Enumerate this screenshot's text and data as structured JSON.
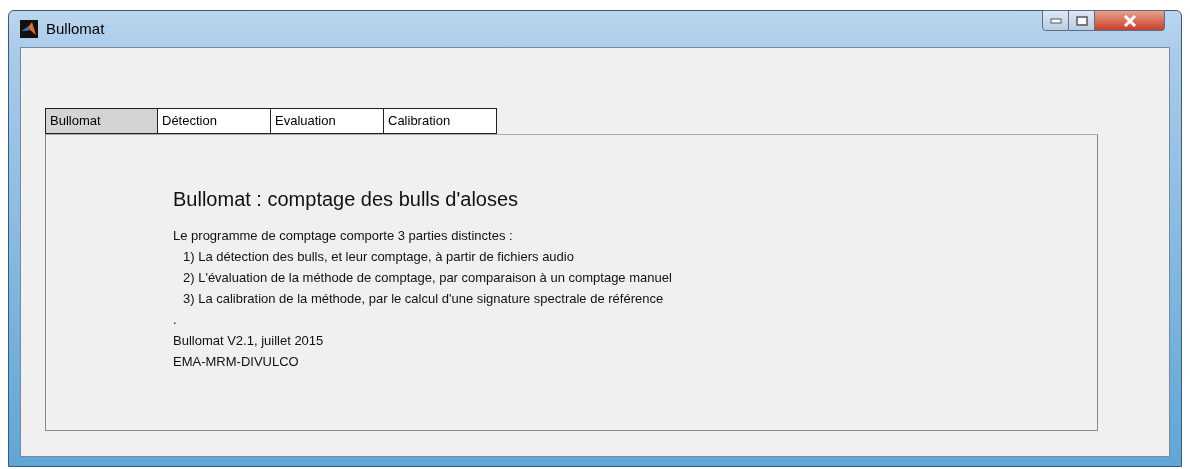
{
  "window": {
    "title": "Bullomat"
  },
  "tabs": [
    {
      "label": "Bullomat",
      "selected": true
    },
    {
      "label": "Détection",
      "selected": false
    },
    {
      "label": "Evaluation",
      "selected": false
    },
    {
      "label": "Calibration",
      "selected": false
    }
  ],
  "panel": {
    "heading": "Bullomat : comptage des bulls d'aloses",
    "lines": [
      {
        "text": "Le programme de comptage comporte 3 parties distinctes :",
        "indented": false
      },
      {
        "text": "1) La détection des bulls, et leur comptage, à partir de fichiers audio",
        "indented": true
      },
      {
        "text": "2) L'évaluation de la méthode de comptage, par comparaison à un comptage manuel",
        "indented": true
      },
      {
        "text": "3) La calibration de la méthode, par le calcul d'une signature spectrale de référence",
        "indented": true
      },
      {
        "text": ".",
        "indented": false
      },
      {
        "text": "Bullomat V2.1, juillet 2015",
        "indented": false
      },
      {
        "text": "EMA-MRM-DIVULCO",
        "indented": false
      }
    ]
  }
}
